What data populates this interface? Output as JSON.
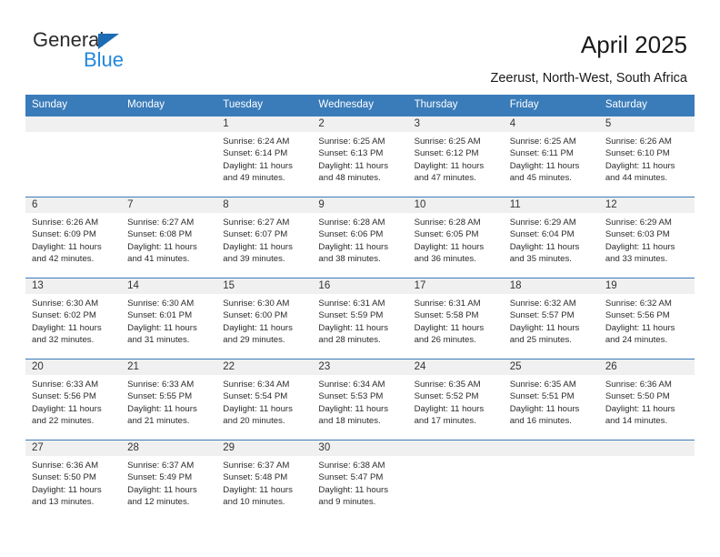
{
  "brand": {
    "name_top": "General",
    "name_bottom": "Blue",
    "triangle_icon": "brand-triangle-icon",
    "accent_dark": "#2b2b2b",
    "accent_blue": "#2288dd",
    "triangle_blue": "#1b6cb5"
  },
  "header": {
    "title": "April 2025",
    "subtitle": "Zeerust, North-West, South Africa"
  },
  "colors": {
    "header_row_bg": "#3a7cba",
    "header_row_text": "#ffffff",
    "daynum_band_bg": "#f0f0f0",
    "week_separator": "#3a7cba",
    "body_text": "#2b2b2b"
  },
  "weekdays": [
    "Sunday",
    "Monday",
    "Tuesday",
    "Wednesday",
    "Thursday",
    "Friday",
    "Saturday"
  ],
  "labels": {
    "sunrise_prefix": "Sunrise:",
    "sunset_prefix": "Sunset:",
    "daylight_prefix": "Daylight:"
  },
  "weeks": [
    [
      {
        "day": "",
        "empty": true,
        "lines": []
      },
      {
        "day": "",
        "empty": true,
        "lines": []
      },
      {
        "day": "1",
        "empty": false,
        "lines": [
          "Sunrise: 6:24 AM",
          "Sunset: 6:14 PM",
          "Daylight: 11 hours",
          "and 49 minutes."
        ]
      },
      {
        "day": "2",
        "empty": false,
        "lines": [
          "Sunrise: 6:25 AM",
          "Sunset: 6:13 PM",
          "Daylight: 11 hours",
          "and 48 minutes."
        ]
      },
      {
        "day": "3",
        "empty": false,
        "lines": [
          "Sunrise: 6:25 AM",
          "Sunset: 6:12 PM",
          "Daylight: 11 hours",
          "and 47 minutes."
        ]
      },
      {
        "day": "4",
        "empty": false,
        "lines": [
          "Sunrise: 6:25 AM",
          "Sunset: 6:11 PM",
          "Daylight: 11 hours",
          "and 45 minutes."
        ]
      },
      {
        "day": "5",
        "empty": false,
        "lines": [
          "Sunrise: 6:26 AM",
          "Sunset: 6:10 PM",
          "Daylight: 11 hours",
          "and 44 minutes."
        ]
      }
    ],
    [
      {
        "day": "6",
        "empty": false,
        "lines": [
          "Sunrise: 6:26 AM",
          "Sunset: 6:09 PM",
          "Daylight: 11 hours",
          "and 42 minutes."
        ]
      },
      {
        "day": "7",
        "empty": false,
        "lines": [
          "Sunrise: 6:27 AM",
          "Sunset: 6:08 PM",
          "Daylight: 11 hours",
          "and 41 minutes."
        ]
      },
      {
        "day": "8",
        "empty": false,
        "lines": [
          "Sunrise: 6:27 AM",
          "Sunset: 6:07 PM",
          "Daylight: 11 hours",
          "and 39 minutes."
        ]
      },
      {
        "day": "9",
        "empty": false,
        "lines": [
          "Sunrise: 6:28 AM",
          "Sunset: 6:06 PM",
          "Daylight: 11 hours",
          "and 38 minutes."
        ]
      },
      {
        "day": "10",
        "empty": false,
        "lines": [
          "Sunrise: 6:28 AM",
          "Sunset: 6:05 PM",
          "Daylight: 11 hours",
          "and 36 minutes."
        ]
      },
      {
        "day": "11",
        "empty": false,
        "lines": [
          "Sunrise: 6:29 AM",
          "Sunset: 6:04 PM",
          "Daylight: 11 hours",
          "and 35 minutes."
        ]
      },
      {
        "day": "12",
        "empty": false,
        "lines": [
          "Sunrise: 6:29 AM",
          "Sunset: 6:03 PM",
          "Daylight: 11 hours",
          "and 33 minutes."
        ]
      }
    ],
    [
      {
        "day": "13",
        "empty": false,
        "lines": [
          "Sunrise: 6:30 AM",
          "Sunset: 6:02 PM",
          "Daylight: 11 hours",
          "and 32 minutes."
        ]
      },
      {
        "day": "14",
        "empty": false,
        "lines": [
          "Sunrise: 6:30 AM",
          "Sunset: 6:01 PM",
          "Daylight: 11 hours",
          "and 31 minutes."
        ]
      },
      {
        "day": "15",
        "empty": false,
        "lines": [
          "Sunrise: 6:30 AM",
          "Sunset: 6:00 PM",
          "Daylight: 11 hours",
          "and 29 minutes."
        ]
      },
      {
        "day": "16",
        "empty": false,
        "lines": [
          "Sunrise: 6:31 AM",
          "Sunset: 5:59 PM",
          "Daylight: 11 hours",
          "and 28 minutes."
        ]
      },
      {
        "day": "17",
        "empty": false,
        "lines": [
          "Sunrise: 6:31 AM",
          "Sunset: 5:58 PM",
          "Daylight: 11 hours",
          "and 26 minutes."
        ]
      },
      {
        "day": "18",
        "empty": false,
        "lines": [
          "Sunrise: 6:32 AM",
          "Sunset: 5:57 PM",
          "Daylight: 11 hours",
          "and 25 minutes."
        ]
      },
      {
        "day": "19",
        "empty": false,
        "lines": [
          "Sunrise: 6:32 AM",
          "Sunset: 5:56 PM",
          "Daylight: 11 hours",
          "and 24 minutes."
        ]
      }
    ],
    [
      {
        "day": "20",
        "empty": false,
        "lines": [
          "Sunrise: 6:33 AM",
          "Sunset: 5:56 PM",
          "Daylight: 11 hours",
          "and 22 minutes."
        ]
      },
      {
        "day": "21",
        "empty": false,
        "lines": [
          "Sunrise: 6:33 AM",
          "Sunset: 5:55 PM",
          "Daylight: 11 hours",
          "and 21 minutes."
        ]
      },
      {
        "day": "22",
        "empty": false,
        "lines": [
          "Sunrise: 6:34 AM",
          "Sunset: 5:54 PM",
          "Daylight: 11 hours",
          "and 20 minutes."
        ]
      },
      {
        "day": "23",
        "empty": false,
        "lines": [
          "Sunrise: 6:34 AM",
          "Sunset: 5:53 PM",
          "Daylight: 11 hours",
          "and 18 minutes."
        ]
      },
      {
        "day": "24",
        "empty": false,
        "lines": [
          "Sunrise: 6:35 AM",
          "Sunset: 5:52 PM",
          "Daylight: 11 hours",
          "and 17 minutes."
        ]
      },
      {
        "day": "25",
        "empty": false,
        "lines": [
          "Sunrise: 6:35 AM",
          "Sunset: 5:51 PM",
          "Daylight: 11 hours",
          "and 16 minutes."
        ]
      },
      {
        "day": "26",
        "empty": false,
        "lines": [
          "Sunrise: 6:36 AM",
          "Sunset: 5:50 PM",
          "Daylight: 11 hours",
          "and 14 minutes."
        ]
      }
    ],
    [
      {
        "day": "27",
        "empty": false,
        "lines": [
          "Sunrise: 6:36 AM",
          "Sunset: 5:50 PM",
          "Daylight: 11 hours",
          "and 13 minutes."
        ]
      },
      {
        "day": "28",
        "empty": false,
        "lines": [
          "Sunrise: 6:37 AM",
          "Sunset: 5:49 PM",
          "Daylight: 11 hours",
          "and 12 minutes."
        ]
      },
      {
        "day": "29",
        "empty": false,
        "lines": [
          "Sunrise: 6:37 AM",
          "Sunset: 5:48 PM",
          "Daylight: 11 hours",
          "and 10 minutes."
        ]
      },
      {
        "day": "30",
        "empty": false,
        "lines": [
          "Sunrise: 6:38 AM",
          "Sunset: 5:47 PM",
          "Daylight: 11 hours",
          "and 9 minutes."
        ]
      },
      {
        "day": "",
        "empty": true,
        "lines": []
      },
      {
        "day": "",
        "empty": true,
        "lines": []
      },
      {
        "day": "",
        "empty": true,
        "lines": []
      }
    ]
  ]
}
